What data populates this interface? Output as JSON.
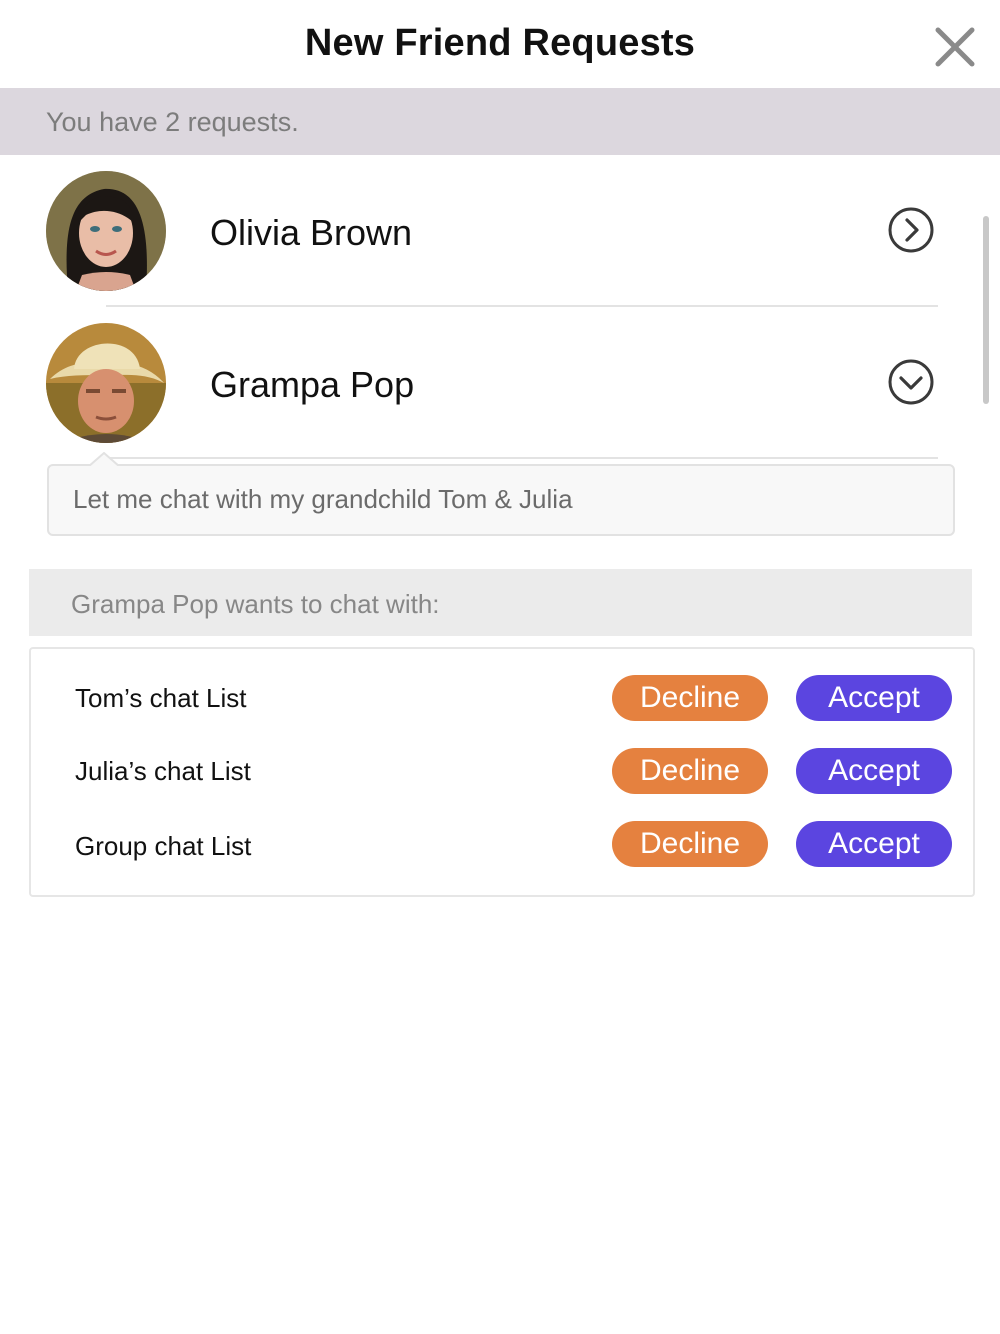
{
  "header": {
    "title": "New Friend Requests",
    "close_icon": "close-icon"
  },
  "summary": {
    "text": "You have 2 requests."
  },
  "requests": [
    {
      "name": "Olivia Brown",
      "avatar_icon": "avatar-photo",
      "chevron_icon": "chevron-right-circle-icon",
      "expanded": false
    },
    {
      "name": "Grampa Pop",
      "avatar_icon": "avatar-photo",
      "chevron_icon": "chevron-down-circle-icon",
      "expanded": true
    }
  ],
  "message": {
    "text": "Let me chat with my grandchild Tom & Julia"
  },
  "wants": {
    "text": "Grampa Pop wants to chat with:"
  },
  "chat_lists": [
    {
      "label": "Tom’s chat List",
      "decline": "Decline",
      "accept": "Accept"
    },
    {
      "label": "Julia’s chat List",
      "decline": "Decline",
      "accept": "Accept"
    },
    {
      "label": "Group chat List",
      "decline": "Decline",
      "accept": "Accept"
    }
  ],
  "colors": {
    "decline": "#e5813f",
    "accept": "#5b45e0",
    "summary_bg": "#dcd7de"
  }
}
